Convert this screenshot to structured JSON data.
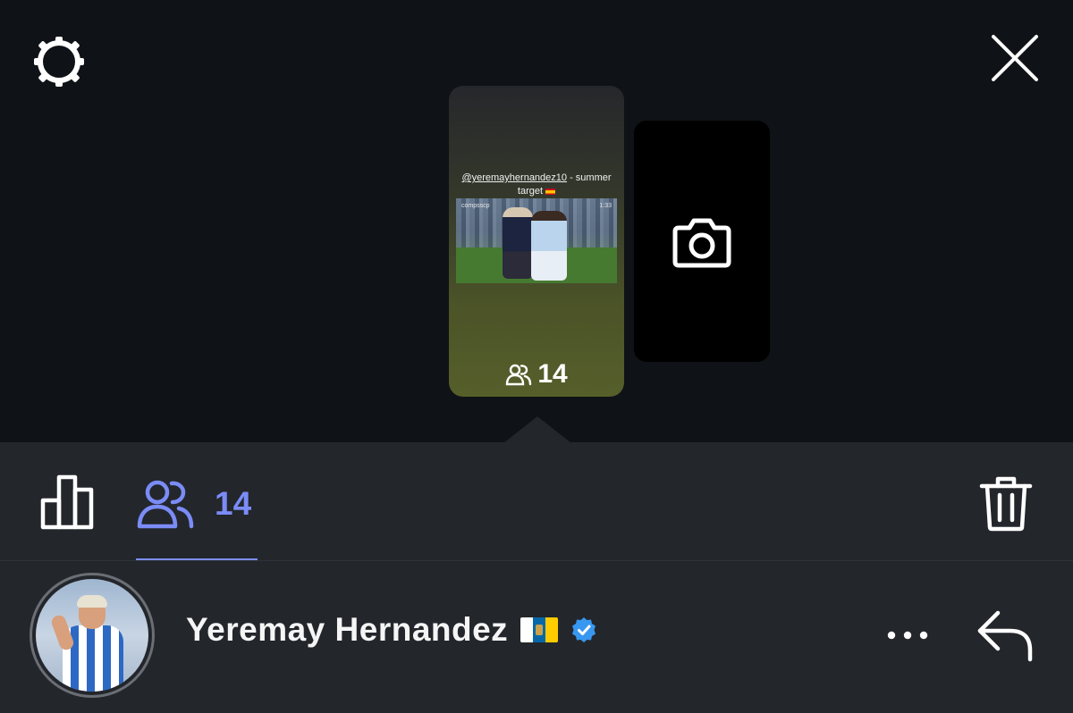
{
  "story": {
    "caption_mention": "@yeremayhernandez10",
    "caption_rest": " - summer target",
    "media_watermark": "compsscp",
    "media_time": "1:33",
    "viewer_count": "14"
  },
  "toolbar": {
    "viewers_count": "14"
  },
  "profile": {
    "name": "Yeremay Hernandez"
  },
  "colors": {
    "accent": "#7b8cf7",
    "verified": "#3897f0",
    "background": "#0f1216",
    "panel": "#23262b"
  },
  "icons": [
    "gear-icon",
    "close-icon",
    "camera-icon",
    "viewers-icon",
    "insights-icon",
    "trash-icon",
    "verified-badge-icon",
    "more-icon",
    "reply-icon"
  ]
}
